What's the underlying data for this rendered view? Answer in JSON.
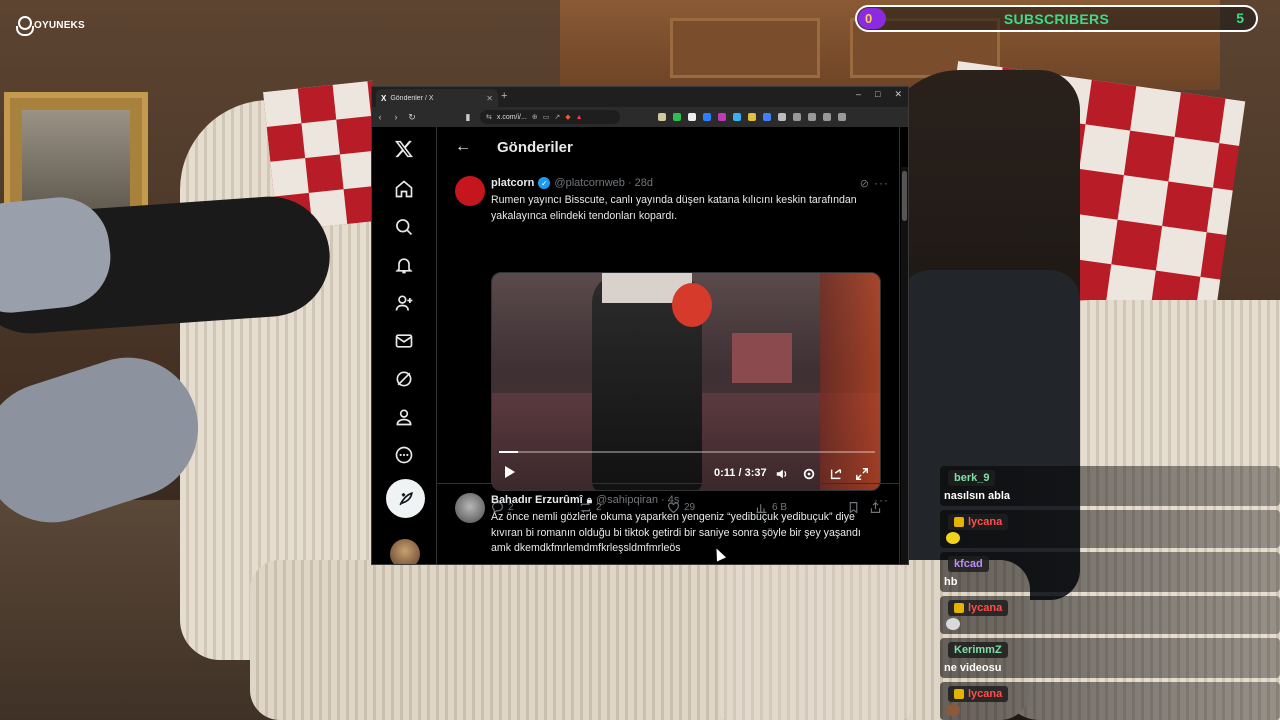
{
  "overlay": {
    "logo_text": "OYUNEKS",
    "subscribers": {
      "label": "SUBSCRIBERS",
      "current": "0",
      "goal": "5",
      "accent": "#8a2be2",
      "text_color": "#3ddc84"
    }
  },
  "browser": {
    "tab_title": "Gönderiler / X",
    "tab_favicon": "X",
    "url": "x.com/i/...",
    "window_controls": [
      "–",
      "□",
      "✕"
    ]
  },
  "x": {
    "header_title": "Gönderiler",
    "nav_icons": [
      "x-logo-icon",
      "home-icon",
      "search-icon",
      "bell-icon",
      "add-user-icon",
      "mail-icon",
      "grok-icon",
      "profile-icon",
      "more-icon"
    ],
    "posts": [
      {
        "name": "platcorn",
        "handle": "@platcornweb · 28d",
        "verified": true,
        "text": "Rumen yayıncı Bisscute, canlı yayında düşen katana kılıcını keskin tarafından yakalayınca elindeki tendonları kopardı.",
        "video": {
          "time": "0:11 / 3:37",
          "progress": 0.05
        },
        "replies": "2",
        "reposts": "2",
        "likes": "29",
        "views": "6 B"
      },
      {
        "name": "Bahadır Erzurûmî",
        "handle": "@sahipqiran · 4s",
        "protected": true,
        "text": "Az önce nemli gözlerle okuma yaparken yengeniz “yedibuçuk yedibuçuk” diye kıvıran bi romanın olduğu bi tiktok getirdi bir saniye sonra şöyle bir şey yaşandı amk dkemdkfmrlemdmfkrleşsldmfmrleös"
      }
    ]
  },
  "chat": {
    "messages": [
      {
        "user": "berk_9",
        "color": "#7fe0a6",
        "text": "nasılsın abla",
        "badge": false
      },
      {
        "user": "lycana",
        "color": "#ff4d4d",
        "text": "",
        "badge": true,
        "emote_color": "#f2d21b"
      },
      {
        "user": "kfcad",
        "color": "#b98cff",
        "text": "hb",
        "badge": false
      },
      {
        "user": "lycana",
        "color": "#ff4d4d",
        "text": "",
        "badge": true,
        "emote_color": "#d9d9d9"
      },
      {
        "user": "KerimmZ",
        "color": "#7fe0a6",
        "text": "ne videosu",
        "badge": false
      },
      {
        "user": "lycana",
        "color": "#ff4d4d",
        "text": "",
        "badge": true,
        "emote_color": "#8a5a3a"
      }
    ]
  }
}
